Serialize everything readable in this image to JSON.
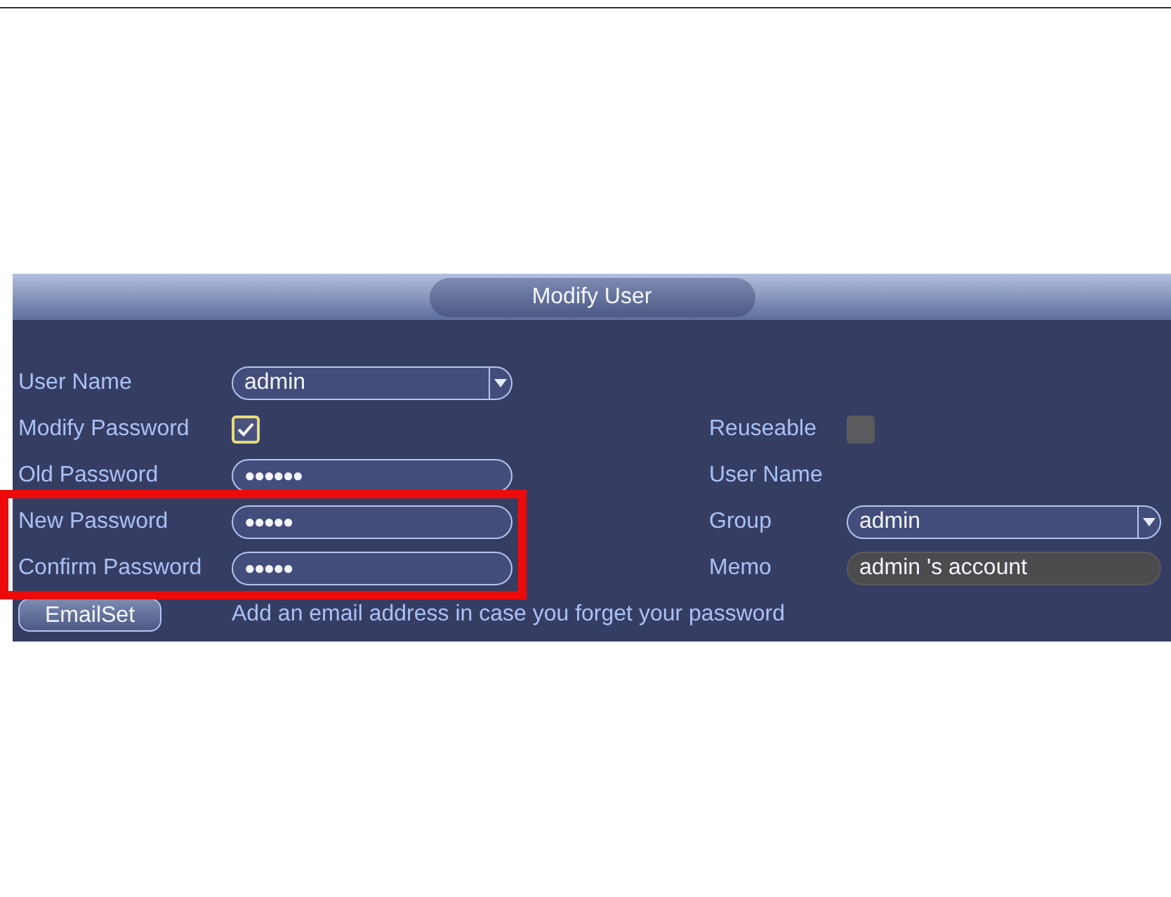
{
  "dialog": {
    "title": "Modify User"
  },
  "left_rows": [
    {
      "kind": "dropdown",
      "label": "User Name",
      "value": "admin",
      "highlighted": false
    },
    {
      "kind": "checkbox",
      "label": "Modify Password",
      "checked": true,
      "highlighted": false
    },
    {
      "kind": "password",
      "label": "Old Password",
      "value": "●●●●●●",
      "highlighted": false
    },
    {
      "kind": "password",
      "label": "New Password",
      "value": "●●●●●",
      "highlighted": true
    },
    {
      "kind": "password",
      "label": "Confirm Password",
      "value": "●●●●●",
      "highlighted": true
    }
  ],
  "right_rows": [
    {
      "kind": "checkbox",
      "label": "Reuseable",
      "checked": false
    },
    {
      "kind": "label",
      "label": "User Name"
    },
    {
      "kind": "dropdown",
      "label": "Group",
      "value": "admin"
    },
    {
      "kind": "text",
      "label": "Memo",
      "value": "admin 's account"
    }
  ],
  "footer": {
    "button": "EmailSet",
    "hint": "Add an email address in case you forget your password"
  }
}
